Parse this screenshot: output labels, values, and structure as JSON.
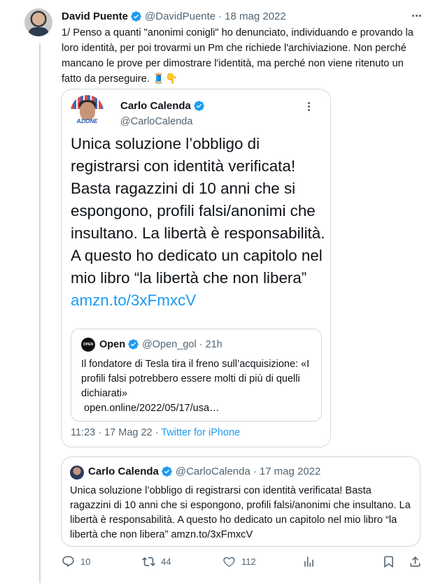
{
  "tweet": {
    "author_name": "David Puente",
    "author_handle": "@DavidPuente",
    "date": "18 mag 2022",
    "text": "1/ Penso a quanti \"anonimi conigli\" ho denunciato, individuando e provando la loro identità, per poi trovarmi un Pm che richiede l'archiviazione. Non perché mancano le prove per dimostrare l'identità, ma perché non viene ritenuto un fatto da perseguire. 🧵👇"
  },
  "screenshot_card": {
    "author_name": "Carlo Calenda",
    "author_handle": "@CarloCalenda",
    "avatar_logo": "AZIONE",
    "text": "Unica soluzione l’obbligo di registrarsi con identità verificata! Basta ragazzini di 10 anni che si espongono, profili falsi/anonimi che insultano. La libertà è responsabilità. A questo ho dedicato un capitolo nel mio libro “la libertà che non libera” ",
    "link": "amzn.to/3xFmxcV",
    "inner_quote": {
      "logo": "OPEN",
      "author_name": "Open",
      "author_handle": "@Open_gol",
      "time": "21h",
      "text": "Il fondatore di Tesla tira il freno sull’acquisizione: «I profili falsi potrebbero essere molti di più di quelli dichiarati»\n open.online/2022/05/17/usa…"
    },
    "timestamp": "11:23 · 17 Mag 22 · ",
    "source": "Twitter for iPhone"
  },
  "quoted_tweet": {
    "author_name": "Carlo Calenda",
    "author_handle": "@CarloCalenda",
    "date": "17 mag 2022",
    "text": "Unica soluzione l’obbligo di registrarsi con identità verificata! Basta ragazzini di 10 anni che si espongono, profili falsi/anonimi che insultano. La libertà è responsabilità. A questo ho dedicato un capitolo nel mio libro “la libertà che non libera” amzn.to/3xFmxcV"
  },
  "actions": {
    "replies": "10",
    "retweets": "44",
    "likes": "112"
  },
  "colors": {
    "accent": "#1d9bf0",
    "muted": "#536471",
    "border": "#cfd9de"
  }
}
